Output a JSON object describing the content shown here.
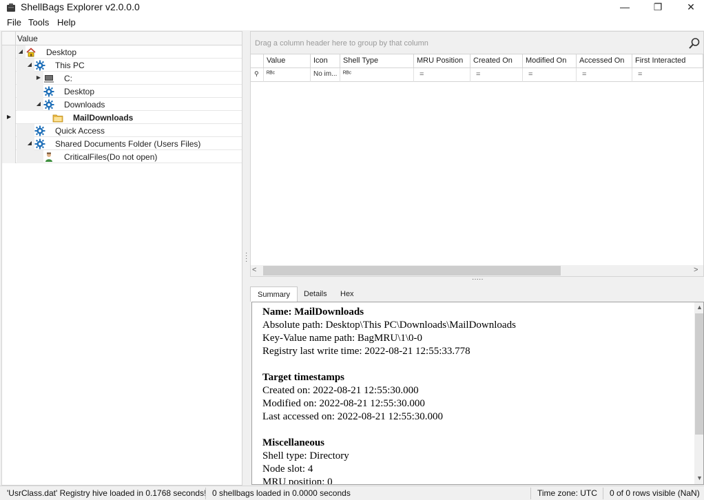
{
  "window": {
    "title": "ShellBags Explorer v2.0.0.0",
    "minimize": "—",
    "maximize": "❐",
    "close": "✕"
  },
  "menu": [
    "File",
    "Tools",
    "Help"
  ],
  "tree": {
    "header": "Value",
    "items": [
      {
        "label": "Desktop",
        "icon": "home-icon",
        "expander": "◢",
        "level": 0
      },
      {
        "label": "This PC",
        "icon": "gear-icon",
        "expander": "◢",
        "level": 1
      },
      {
        "label": "C:",
        "icon": "drive-icon",
        "expander": "▶",
        "level": 2
      },
      {
        "label": "Desktop",
        "icon": "gear-icon",
        "expander": "",
        "level": 2
      },
      {
        "label": "Downloads",
        "icon": "gear-icon",
        "expander": "◢",
        "level": 2
      },
      {
        "label": "MailDownloads",
        "icon": "folder-icon",
        "expander": "",
        "level": 3,
        "selected": true
      },
      {
        "label": "Quick Access",
        "icon": "gear-icon",
        "expander": "",
        "level": 1
      },
      {
        "label": "Shared Documents Folder (Users Files)",
        "icon": "gear-icon",
        "expander": "◢",
        "level": 1
      },
      {
        "label": "CriticalFiles(Do not open)",
        "icon": "user-icon",
        "expander": "",
        "level": 2
      }
    ]
  },
  "grid": {
    "group_hint": "Drag a column header here to group by that column",
    "columns": [
      "Value",
      "Icon",
      "Shell Type",
      "MRU Position",
      "Created On",
      "Modified On",
      "Accessed On",
      "First Interacted"
    ],
    "filter_row": [
      "ᴿᴮᶜ",
      "No im...",
      "ᴿᴮᶜ",
      "=",
      "=",
      "=",
      "=",
      "="
    ],
    "scroll_left": "<",
    "scroll_right": ">"
  },
  "details": {
    "tabs": [
      "Summary",
      "Details",
      "Hex"
    ],
    "active_tab": "Summary",
    "summary": {
      "name_line": "Name: MailDownloads",
      "absolute_path": "Absolute path: Desktop\\This PC\\Downloads\\MailDownloads",
      "key_value": "Key-Value name path: BagMRU\\1\\0-0",
      "registry_write": "Registry last write time: 2022-08-21 12:55:33.778",
      "target_heading": "Target timestamps",
      "created": "Created on: 2022-08-21 12:55:30.000",
      "modified": "Modified on: 2022-08-21 12:55:30.000",
      "accessed": "Last accessed on: 2022-08-21 12:55:30.000",
      "misc_heading": "Miscellaneous",
      "shell_type": "Shell type: Directory",
      "node_slot": "Node slot: 4",
      "mru_position": "MRU position: 0"
    }
  },
  "status": {
    "hive": "'UsrClass.dat' Registry hive loaded in 0.1768 seconds!",
    "shellbags": "0 shellbags loaded in 0.0000 seconds",
    "timezone": "Time zone: UTC",
    "rows": "0 of 0 rows visible (NaN)"
  },
  "colors": {
    "gear": "#1e6fb8",
    "folder": "#e8b84a",
    "selection": "#ffffff"
  }
}
